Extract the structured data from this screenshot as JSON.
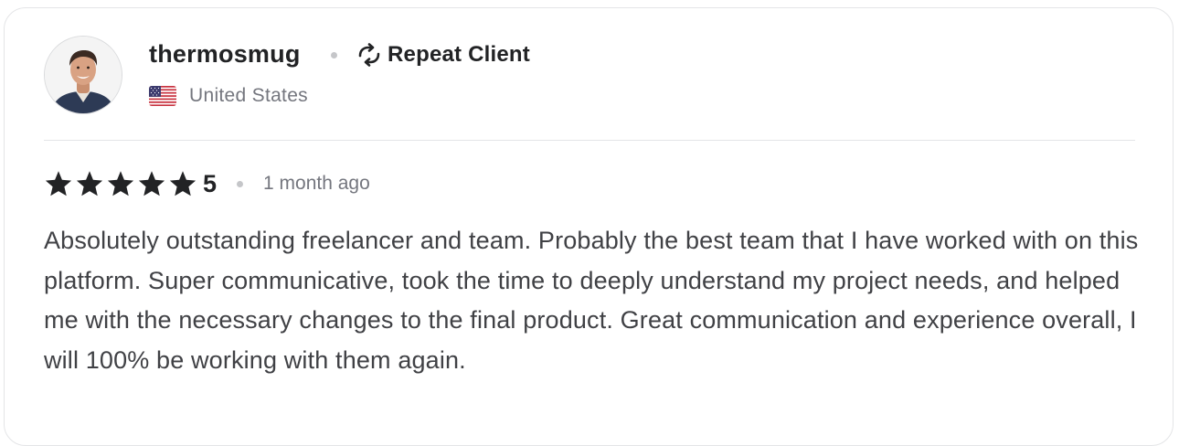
{
  "reviewer": {
    "username": "thermosmug",
    "badge_label": "Repeat Client",
    "badge_icon": "repeat-icon",
    "country": "United States",
    "flag_icon": "us-flag-icon",
    "avatar_icon": "user-avatar"
  },
  "rating": {
    "stars": 5,
    "max_stars": 5,
    "value_text": "5",
    "time_ago": "1 month ago"
  },
  "review": {
    "text": "Absolutely outstanding freelancer and team. Probably the best team that I have worked with on this platform. Super communicative, took the time to deeply understand my project needs, and helped me with the necessary changes to the final product. Great communication and experience overall, I will 100% be working with them again."
  },
  "colors": {
    "text_primary": "#222325",
    "text_body": "#404145",
    "text_muted": "#74767e",
    "divider": "#e4e5e7",
    "star": "#222325"
  }
}
